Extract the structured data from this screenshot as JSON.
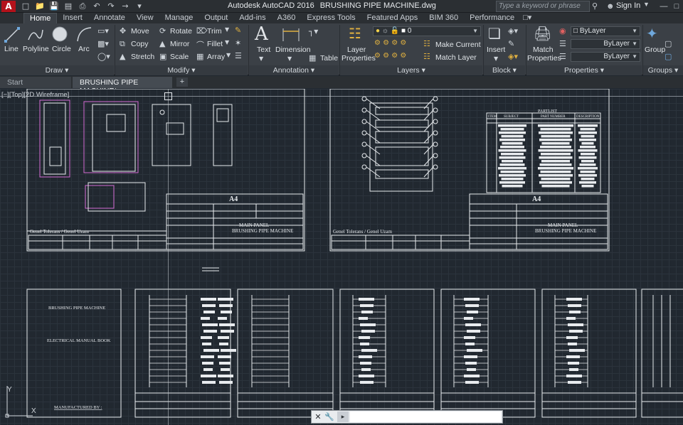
{
  "titlebar": {
    "app_logo": "A",
    "app_name": "Autodesk AutoCAD 2016",
    "file_name": "BRUSHING PIPE MACHINE.dwg",
    "search_placeholder": "Type a keyword or phrase",
    "signin_label": "Sign In"
  },
  "ribbon_tabs": [
    "Home",
    "Insert",
    "Annotate",
    "View",
    "Manage",
    "Output",
    "Add-ins",
    "A360",
    "Express Tools",
    "Featured Apps",
    "BIM 360",
    "Performance"
  ],
  "ribbon": {
    "draw": {
      "label": "Draw",
      "line": "Line",
      "polyline": "Polyline",
      "circle": "Circle",
      "arc": "Arc"
    },
    "modify": {
      "label": "Modify",
      "move": "Move",
      "rotate": "Rotate",
      "trim": "Trim",
      "copy": "Copy",
      "mirror": "Mirror",
      "fillet": "Fillet",
      "stretch": "Stretch",
      "scale": "Scale",
      "array": "Array"
    },
    "annotation": {
      "label": "Annotation",
      "text": "Text",
      "dimension": "Dimension",
      "table": "Table"
    },
    "layers": {
      "label": "Layers",
      "layer_properties_1": "Layer",
      "layer_properties_2": "Properties",
      "current_layer": "0",
      "make_current": "Make Current",
      "match_layer": "Match Layer"
    },
    "block": {
      "label": "Block",
      "insert": "Insert"
    },
    "properties": {
      "label": "Properties",
      "match_1": "Match",
      "match_2": "Properties",
      "color": "ByLayer",
      "linetype": "ByLayer",
      "lineweight": "ByLayer"
    },
    "groups": {
      "label": "Groups",
      "group": "Group"
    }
  },
  "doc_tabs": {
    "start": "Start",
    "active": "BRUSHING PIPE MACHINE*",
    "new": "+"
  },
  "viewport_label": "[−][Top][2D Wireframe]",
  "ucs": {
    "y": "Y",
    "x": "X"
  },
  "drawing": {
    "sheet1": {
      "size": "A4",
      "title": "MAIN PANEL",
      "subtitle": "BRUSHING PIPE MACHINE",
      "tolerance": "Genel Tolerans / Genel Uzam"
    },
    "sheet2": {
      "size": "A4",
      "title": "MAIN PANEL",
      "subtitle": "BRUSHING PIPE MACHINE",
      "tolerance": "Genel Tolerans / Genel Uzam",
      "partlist": "PARTLIST",
      "col_item": "ITEM",
      "col_subject": "SUBJECT",
      "col_part": "PART NUMBER",
      "col_desc": "DESCRIPTION"
    },
    "cover": {
      "line1": "BRUSHING PIPE MACHINE",
      "line2": "ELECTRICAL MANUAL BOOK",
      "line3": "MANUFACTURED BY :"
    }
  },
  "command": {
    "prompt_icon": "▸",
    "input": ""
  }
}
